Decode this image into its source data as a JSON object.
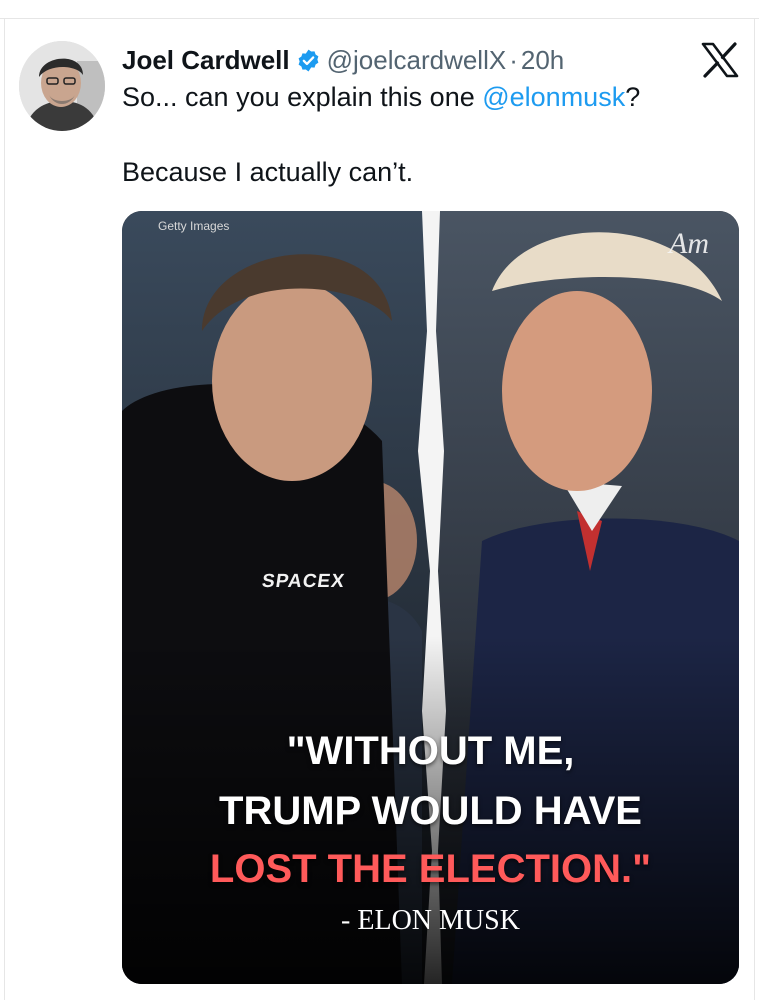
{
  "tweet": {
    "author_name": "Joel Cardwell",
    "handle": "@joelcardwellX",
    "separator": "·",
    "time": "20h",
    "line1_prefix": "So... can you explain this one ",
    "mention": "@elonmusk",
    "line1_suffix": "?",
    "line2": "Because I actually can’t."
  },
  "media": {
    "credit": "Getty Images",
    "watermark": "Am",
    "shirt_logo": "SPACEX",
    "quote_line1": "\"WITHOUT ME,",
    "quote_line2": "TRUMP WOULD HAVE",
    "quote_line3": "LOST THE ELECTION.\"",
    "attribution": "- ELON MUSK"
  },
  "icons": {
    "verified": "verified-badge-icon",
    "platform": "x-logo-icon"
  },
  "colors": {
    "link": "#1d9bf0",
    "verified": "#1d9bf0",
    "meta": "#536471",
    "quote_highlight": "#ff5a5a"
  }
}
